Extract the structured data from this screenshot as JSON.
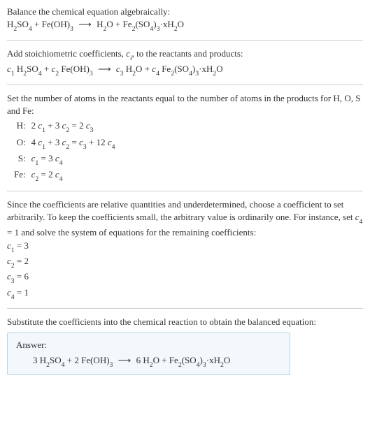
{
  "s1": {
    "line1": "Balance the chemical equation algebraically:",
    "eq_lhs1": "H",
    "eq_lhs2": "SO",
    "eq_lhs3": " + Fe(OH)",
    "arrow": "⟶",
    "eq_rhs1": "H",
    "eq_rhs2": "O + Fe",
    "eq_rhs3": "(SO",
    "eq_rhs4": ")",
    "eq_rhs5": "·xH",
    "eq_rhs6": "O",
    "sub2": "2",
    "sub4": "4",
    "sub3": "3"
  },
  "s2": {
    "line1a": "Add stoichiometric coefficients, ",
    "ci_c": "c",
    "ci_i": "i",
    "line1b": ", to the reactants and products:",
    "c1": "c",
    "n1": "1",
    "sp1": " H",
    "so": "SO",
    "plus": " + ",
    "c2": "c",
    "n2": "2",
    "sp2": " Fe(OH)",
    "arrow": "⟶",
    "c3": "c",
    "n3": "3",
    "sp3": " H",
    "o": "O + ",
    "c4": "c",
    "n4": "4",
    "sp4": " Fe",
    "so4p": "(SO",
    "close": ")",
    "xh2o": "·xH",
    "oend": "O",
    "sub2": "2",
    "sub4": "4",
    "sub3": "3"
  },
  "s3": {
    "line1": "Set the number of atoms in the reactants equal to the number of atoms in the products for H, O, S and Fe:",
    "rows": {
      "h_lab": "H:",
      "h_eq_a": "2 ",
      "h_c1": "c",
      "h_n1": "1",
      "h_mid": " + 3 ",
      "h_c2": "c",
      "h_n2": "2",
      "h_eq": " = 2 ",
      "h_c3": "c",
      "h_n3": "3",
      "o_lab": "O:",
      "o_eq_a": "4 ",
      "o_c1": "c",
      "o_n1": "1",
      "o_mid": " + 3 ",
      "o_c2": "c",
      "o_n2": "2",
      "o_eq": " = ",
      "o_c3": "c",
      "o_n3": "3",
      "o_plus": " + 12 ",
      "o_c4": "c",
      "o_n4": "4",
      "s_lab": "S:",
      "s_c1": "c",
      "s_n1": "1",
      "s_eq": " = 3 ",
      "s_c4": "c",
      "s_n4": "4",
      "fe_lab": "Fe:",
      "fe_c2": "c",
      "fe_n2": "2",
      "fe_eq": " = 2 ",
      "fe_c4": "c",
      "fe_n4": "4"
    }
  },
  "s4": {
    "line1": "Since the coefficients are relative quantities and underdetermined, choose a coefficient to set arbitrarily. To keep the coefficients small, the arbitrary value is ordinarily one. For instance, set ",
    "c4": "c",
    "n4": "4",
    "line1b": " = 1 and solve the system of equations for the remaining coefficients:",
    "r1_c": "c",
    "r1_n": "1",
    "r1_v": " = 3",
    "r2_c": "c",
    "r2_n": "2",
    "r2_v": " = 2",
    "r3_c": "c",
    "r3_n": "3",
    "r3_v": " = 6",
    "r4_c": "c",
    "r4_n": "4",
    "r4_v": " = 1"
  },
  "s5": {
    "line1": "Substitute the coefficients into the chemical reaction to obtain the balanced equation:",
    "answer_label": "Answer:",
    "eq_3": "3 H",
    "so": "SO",
    "plus1": " + 2 Fe(OH)",
    "arrow": "⟶",
    "six": "6 H",
    "oplus": "O + Fe",
    "so4o": "(SO",
    "close": ")",
    "xh2o": "·xH",
    "oend": "O",
    "sub2": "2",
    "sub4": "4",
    "sub3": "3"
  }
}
